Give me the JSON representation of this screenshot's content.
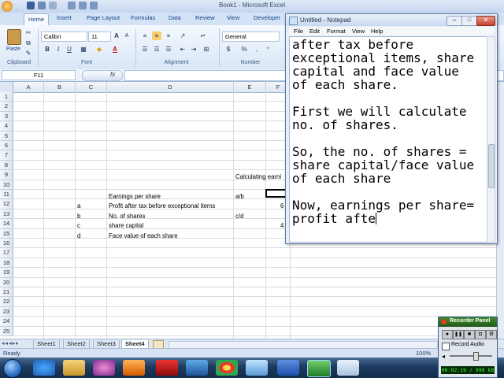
{
  "excel": {
    "title": "Book1 - Microsoft Excel",
    "tabs": [
      "Home",
      "Insert",
      "Page Layout",
      "Formulas",
      "Data",
      "Review",
      "View",
      "Developer"
    ],
    "clipboard": {
      "paste_label": "Paste",
      "group_label": "Clipboard"
    },
    "font": {
      "name": "Calibri",
      "size": "11",
      "group_label": "Font",
      "bold": "B",
      "italic": "I",
      "underline": "U",
      "grow": "A",
      "shrink": "A",
      "color_letter": "A"
    },
    "alignment": {
      "group_label": "Alignment"
    },
    "number": {
      "format": "General",
      "group_label": "Number",
      "currency": "$",
      "percent": "%"
    },
    "name_box": "F11",
    "fx": "fx",
    "columns": [
      "A",
      "B",
      "C",
      "D",
      "E",
      "F"
    ],
    "rows": [
      "1",
      "2",
      "3",
      "4",
      "5",
      "6",
      "7",
      "8",
      "9",
      "10",
      "11",
      "12",
      "13",
      "14",
      "15",
      "16",
      "17",
      "18",
      "19",
      "20",
      "21",
      "22",
      "23",
      "24",
      "25"
    ],
    "cells": {
      "E9": "Calculating earni",
      "D11": "Earnings per share",
      "E11": "a/b",
      "C12": "a",
      "D12": "Profit after tax before exceptional items",
      "F12": "6",
      "C13": "b",
      "D13": "No. of shares",
      "E13": "c/d",
      "C14": "c",
      "D14": "share capital",
      "F14": "4",
      "C15": "d",
      "D15": "Face value of each share"
    },
    "sheets": [
      "Sheet1",
      "Sheet2",
      "Sheet3",
      "Sheet4"
    ],
    "active_sheet": "Sheet4",
    "status": "Ready",
    "zoom": "100%"
  },
  "notepad": {
    "title": "Untitled - Notepad",
    "menu": [
      "File",
      "Edit",
      "Format",
      "View",
      "Help"
    ],
    "text": "after tax before\nexceptional items, share\ncapital and face value\nof each share.\n\nFirst we will calculate\nno. of shares.\n\nSo, the no. of shares =\nshare capital/face value\nof each share\n\nNow, earnings per share=\nprofit afte"
  },
  "recorder": {
    "title": "Recorder Panel",
    "record_audio": "Record Audio",
    "time": "00:02:19 / 999 kB"
  },
  "colors": {
    "excel_accent": "#15428b",
    "taskbar": "#1d3a5f",
    "recorder": "#2f6b1f"
  }
}
